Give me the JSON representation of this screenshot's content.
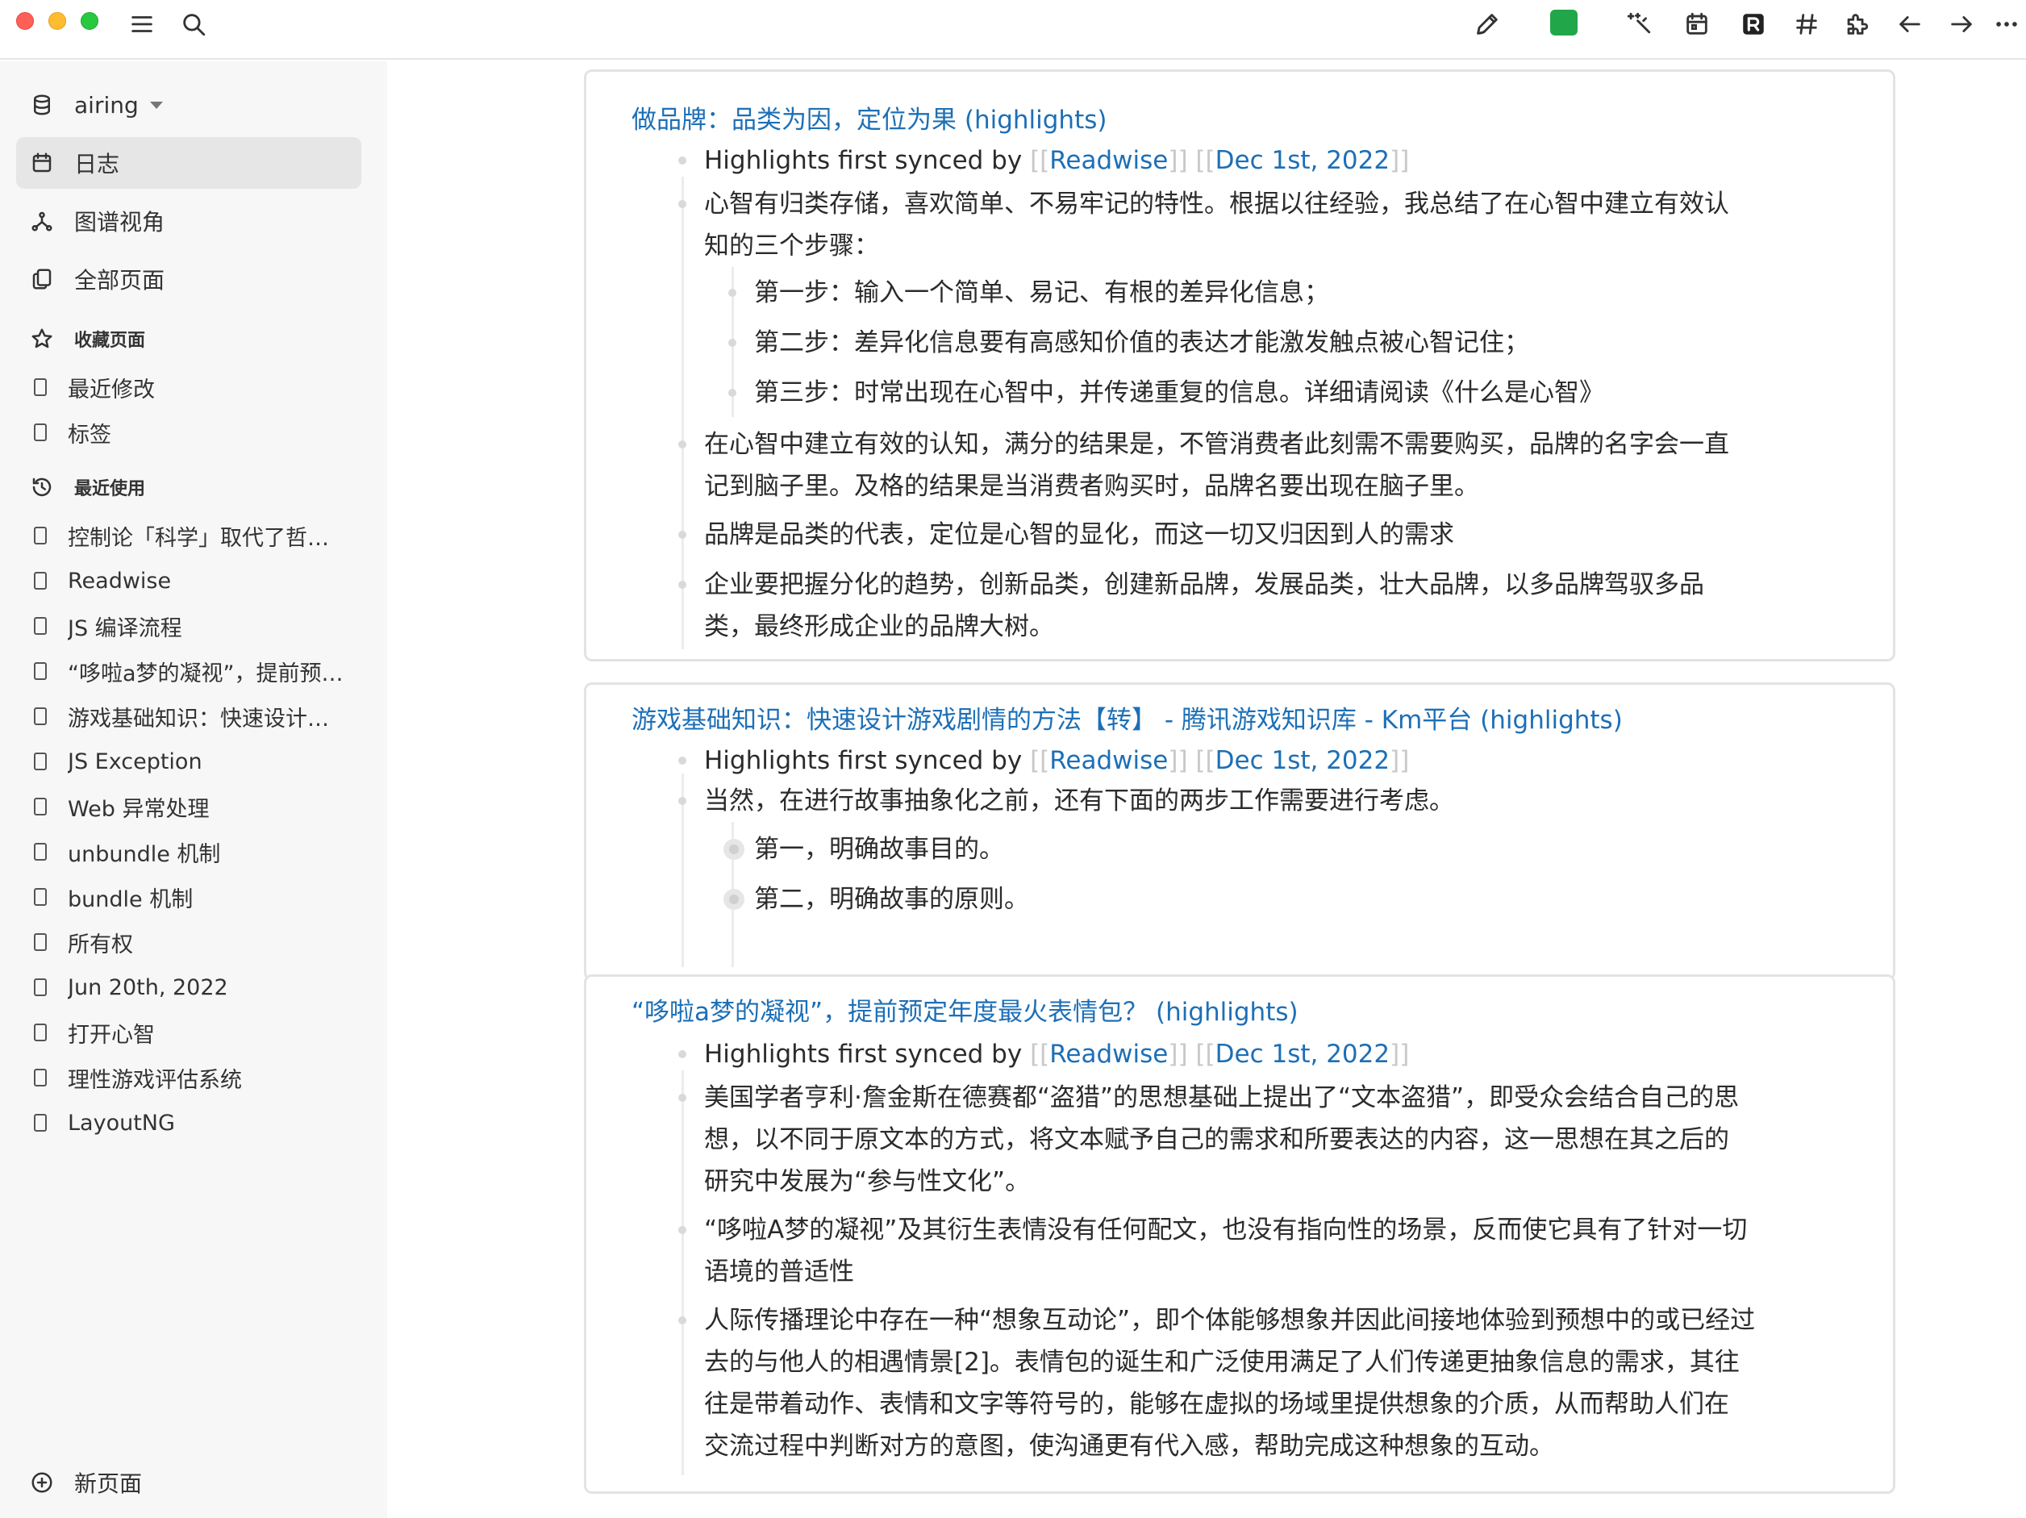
{
  "sidebar": {
    "graph_name": "airing",
    "nav": [
      {
        "label": "日志",
        "icon": "calendar-icon"
      },
      {
        "label": "图谱视角",
        "icon": "graph-icon"
      },
      {
        "label": "全部页面",
        "icon": "pages-icon"
      }
    ],
    "favorites_label": "收藏页面",
    "favorites": [
      "最近修改",
      "标签"
    ],
    "recent_label": "最近使用",
    "recent": [
      "控制论「科学」取代了哲…",
      "Readwise",
      "JS 编译流程",
      "“哆啦a梦的凝视”，提前预…",
      "游戏基础知识：快速设计…",
      "JS Exception",
      "Web 异常处理",
      "unbundle 机制",
      "bundle 机制",
      "所有权",
      "Jun 20th, 2022",
      "打开心智",
      "理性游戏评估系统",
      "LayoutNG"
    ],
    "new_page_label": "新页面"
  },
  "common": {
    "synced_prefix": "Highlights first synced by ",
    "readwise": "Readwise",
    "date": "Dec 1st, 2022",
    "open": "[[",
    "close": "]]"
  },
  "cards": [
    {
      "title": "做品牌：品类为因，定位为果 (highlights)",
      "items": [
        {
          "lines": [
            "心智有归类存储，喜欢简单、不易牢记的特性。根据以往经验，我总结了在心智中建立有效认",
            "知的三个步骤："
          ]
        },
        {
          "lines": [
            "第一步：输入一个简单、易记、有根的差异化信息；"
          ]
        },
        {
          "lines": [
            "第二步：差异化信息要有高感知价值的表达才能激发触点被心智记住；"
          ]
        },
        {
          "lines": [
            "第三步：时常出现在心智中，并传递重复的信息。详细请阅读《什么是心智》"
          ]
        },
        {
          "lines": [
            "在心智中建立有效的认知，满分的结果是，不管消费者此刻需不需要购买，品牌的名字会一直",
            "记到脑子里。及格的结果是当消费者购买时，品牌名要出现在脑子里。"
          ]
        },
        {
          "lines": [
            "品牌是品类的代表，定位是心智的显化，而这一切又归因到人的需求"
          ]
        },
        {
          "lines": [
            "企业要把握分化的趋势，创新品类，创建新品牌，发展品类，壮大品牌，以多品牌驾驭多品",
            "类，最终形成企业的品牌大树。"
          ]
        }
      ]
    },
    {
      "title": "游戏基础知识：快速设计游戏剧情的方法【转】 - 腾讯游戏知识库 - Km平台 (highlights)",
      "items": [
        {
          "lines": [
            "当然，在进行故事抽象化之前，还有下面的两步工作需要进行考虑。"
          ]
        },
        {
          "lines": [
            "第一，明确故事目的。"
          ]
        },
        {
          "lines": [
            "第二，明确故事的原则。"
          ]
        }
      ]
    },
    {
      "title": "“哆啦a梦的凝视”，提前预定年度最火表情包？ (highlights)",
      "items": [
        {
          "lines": [
            "美国学者亨利·詹金斯在德赛都“盗猎”的思想基础上提出了“文本盗猎”，即受众会结合自己的思",
            "想，以不同于原文本的方式，将文本赋予自己的需求和所要表达的内容，这一思想在其之后的",
            "研究中发展为“参与性文化”。"
          ]
        },
        {
          "lines": [
            "“哆啦A梦的凝视”及其衍生表情没有任何配文，也没有指向性的场景，反而使它具有了针对一切",
            "语境的普适性"
          ]
        },
        {
          "lines": [
            "人际传播理论中存在一种“想象互动论”，即个体能够想象并因此间接地体验到预想中的或已经过",
            "去的与他人的相遇情景[2]。表情包的诞生和广泛使用满足了人们传递更抽象信息的需求，其往",
            "往是带着动作、表情和文字等符号的，能够在虚拟的场域里提供想象的介质，从而帮助人们在",
            "交流过程中判断对方的意图，使沟通更有代入感，帮助完成这种想象的互动。"
          ]
        }
      ]
    }
  ]
}
